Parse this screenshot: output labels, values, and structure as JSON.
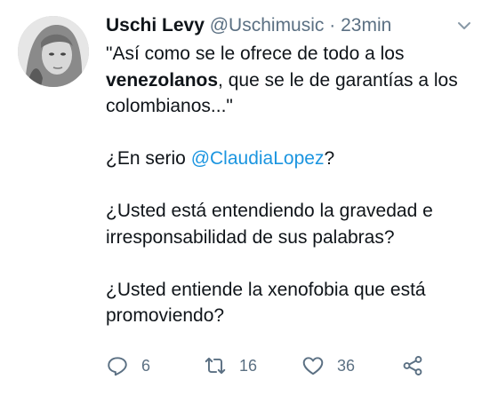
{
  "tweet": {
    "display_name": "Uschi Levy",
    "handle": "@Uschimusic",
    "separator": "·",
    "time": "23min",
    "line1_pre": "\"Así como se le ofrece de todo a los",
    "line2_bold": "venezolanos",
    "line2_rest": ", que se le de garantías a los",
    "line3": "colombianos...\"",
    "q1_pre": "¿En serio ",
    "q1_mention": "@ClaudiaLopez",
    "q1_post": "?",
    "q2_line1": "¿Usted está entendiendo la gravedad e",
    "q2_line2": "irresponsabilidad de sus palabras?",
    "q3_line1": "¿Usted entiende la xenofobia que está",
    "q3_line2": "promoviendo?"
  },
  "actions": {
    "reply_count": "6",
    "retweet_count": "16",
    "like_count": "36"
  },
  "icons": {
    "more": "chevron-down-icon",
    "reply": "reply-icon",
    "retweet": "retweet-icon",
    "like": "heart-icon",
    "share": "share-icon"
  },
  "colors": {
    "mention": "#1b95e0",
    "secondary_text": "#5b7083"
  }
}
